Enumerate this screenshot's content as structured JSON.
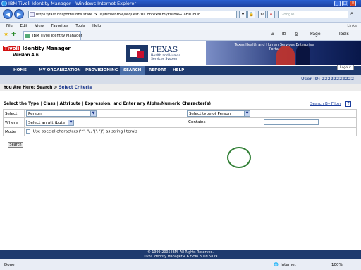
{
  "browser": {
    "title": "IBM Tivoli Identity Manager - Windows Internet Explorer",
    "url": "https://fast.hhsportal.hhs.state.tx.us/itim/enrole/request?UIContext=myEnrole&Tab=ToDo",
    "search_placeholder": "Google",
    "links_label": "Links",
    "menu": [
      "File",
      "Edit",
      "View",
      "Favorites",
      "Tools",
      "Help"
    ],
    "tab_title": "IBM Tivoli Identity Manager",
    "page_menu": "Page",
    "tools_menu": "Tools",
    "status_zone": "Internet",
    "zoom": "100%",
    "status_text": "Done"
  },
  "header": {
    "tivoli": "Tivoli",
    "product": "Identity Manager",
    "version": "Version 4.6",
    "texas": "TEXAS",
    "texas_sub": "Health and Human Services System",
    "banner": "Texas Health and Human Services Enterprise Portal",
    "logout": "Logout"
  },
  "nav": [
    "HOME",
    "MY ORGANIZATION",
    "PROVISIONING",
    "SEARCH",
    "REPORT",
    "HELP"
  ],
  "user_id": "User ID: 22222222222",
  "breadcrumb": {
    "prefix": "You Are Here: Search >",
    "current": "Select Criteria"
  },
  "instruction": "Select the Type | Class | Attribute | Expression, and Enter any Alpha/Numeric Character(s)",
  "search_by_filter": "Search By Filter",
  "criteria": {
    "select_label": "Select",
    "select_value": "Person",
    "type_value": "Select type of Person",
    "where_label": "Where",
    "attribute_value": "Select an attribute",
    "operator_value": "Contains",
    "mode_label": "Mode",
    "mode_option": "Use special characters ('*', '\\', '(', ')') as string literals"
  },
  "search_button": "Search",
  "footer": {
    "line1": "© 1999-2005 IBM. All Rights Reserved.",
    "line2": "Tivoli Identity Manager 4.6 FP98 Build 5839"
  },
  "colors": {
    "nav_bg": "#1e3a6e",
    "nav_active": "#4a6fa8",
    "highlight_circle": "#2e7d32"
  }
}
